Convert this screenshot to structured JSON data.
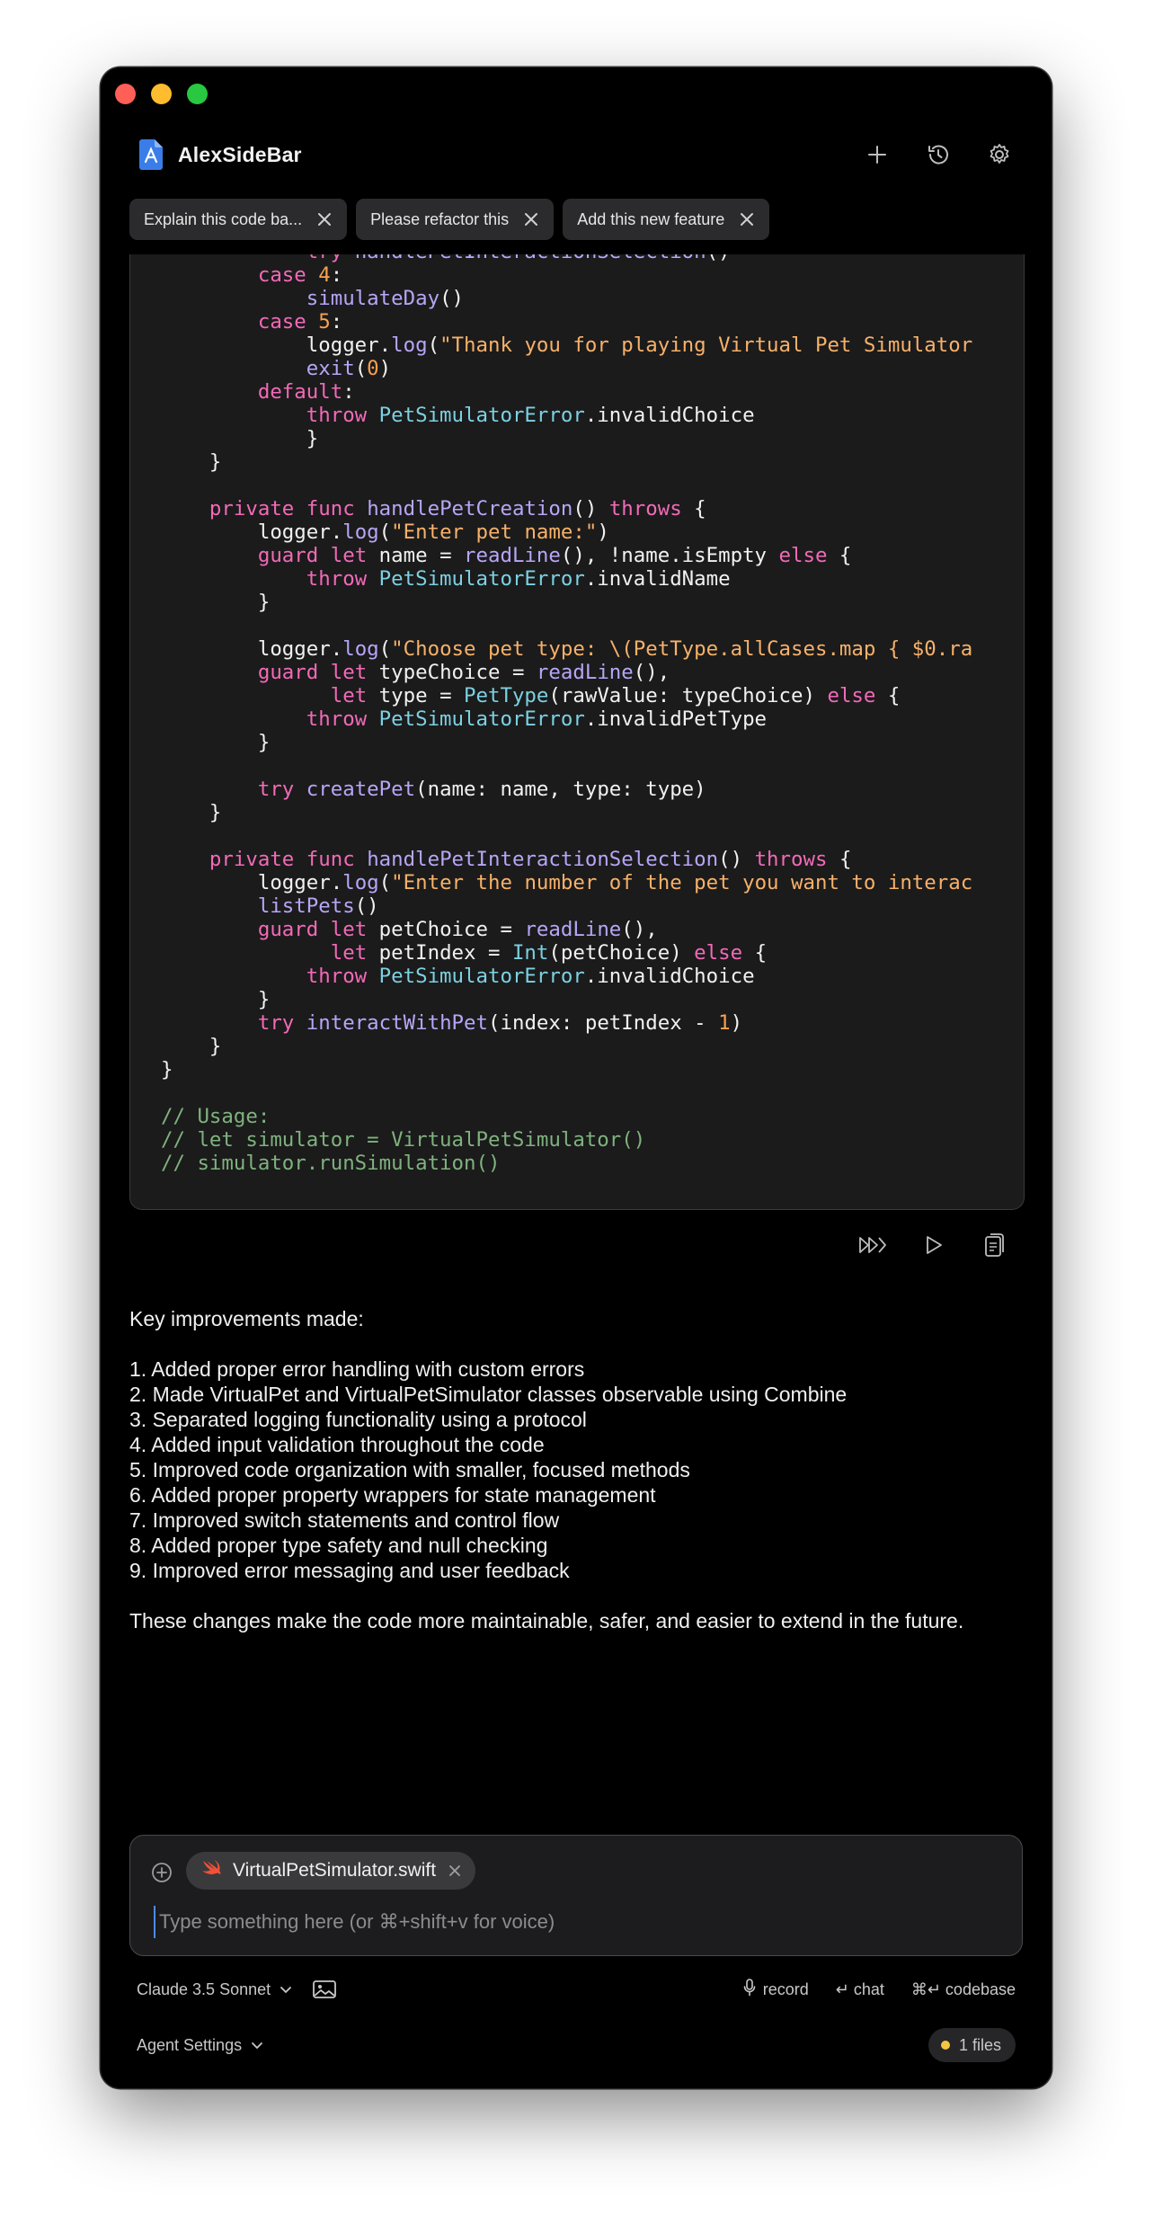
{
  "app": {
    "title": "AlexSideBar"
  },
  "colors": {
    "window_bg": "#000000",
    "accent_cursor": "#4d8af0",
    "status_dot": "#f5c542"
  },
  "header": {
    "icons": [
      "plus-icon",
      "history-icon",
      "gear-icon"
    ]
  },
  "tabs": [
    {
      "label": "Explain this code ba..."
    },
    {
      "label": "Please refactor this"
    },
    {
      "label": "Add this new feature"
    }
  ],
  "code": {
    "language": "swift",
    "lines": [
      "            try handlePetInteractionSelection()",
      "        case 4:",
      "            simulateDay()",
      "        case 5:",
      "            logger.log(\"Thank you for playing Virtual Pet Simulator",
      "            exit(0)",
      "        default:",
      "            throw PetSimulatorError.invalidChoice",
      "            }",
      "    }",
      "",
      "    private func handlePetCreation() throws {",
      "        logger.log(\"Enter pet name:\")",
      "        guard let name = readLine(), !name.isEmpty else {",
      "            throw PetSimulatorError.invalidName",
      "        }",
      "",
      "        logger.log(\"Choose pet type: \\(PetType.allCases.map { $0.ra",
      "        guard let typeChoice = readLine(),",
      "              let type = PetType(rawValue: typeChoice) else {",
      "            throw PetSimulatorError.invalidPetType",
      "        }",
      "",
      "        try createPet(name: name, type: type)",
      "    }",
      "",
      "    private func handlePetInteractionSelection() throws {",
      "        logger.log(\"Enter the number of the pet you want to interac",
      "        listPets()",
      "        guard let petChoice = readLine(),",
      "              let petIndex = Int(petChoice) else {",
      "            throw PetSimulatorError.invalidChoice",
      "        }",
      "        try interactWithPet(index: petIndex - 1)",
      "    }",
      "}",
      "",
      "// Usage:",
      "// let simulator = VirtualPetSimulator()",
      "// simulator.runSimulation()"
    ]
  },
  "code_actions": [
    "apply-all-icon",
    "run-icon",
    "copy-icon"
  ],
  "response": {
    "intro": "Key improvements made:",
    "items": [
      "1. Added proper error handling with custom errors",
      "2. Made VirtualPet and VirtualPetSimulator classes observable using Combine",
      "3. Separated logging functionality using a protocol",
      "4. Added input validation throughout the code",
      "5. Improved code organization with smaller, focused methods",
      "6. Added proper property wrappers for state management",
      "7. Improved switch statements and control flow",
      "8. Added proper type safety and null checking",
      "9. Improved error messaging and user feedback"
    ],
    "conclusion": "These changes make the code more maintainable, safer, and easier to extend in the future."
  },
  "input": {
    "attached_file": "VirtualPetSimulator.swift",
    "placeholder": "Type something here (or ⌘+shift+v for voice)",
    "value": ""
  },
  "bottom": {
    "model": "Claude 3.5 Sonnet",
    "record": "record",
    "chat": "↵ chat",
    "codebase": "⌘↵ codebase"
  },
  "agent": {
    "settings_label": "Agent Settings",
    "files_count": "1 files"
  }
}
